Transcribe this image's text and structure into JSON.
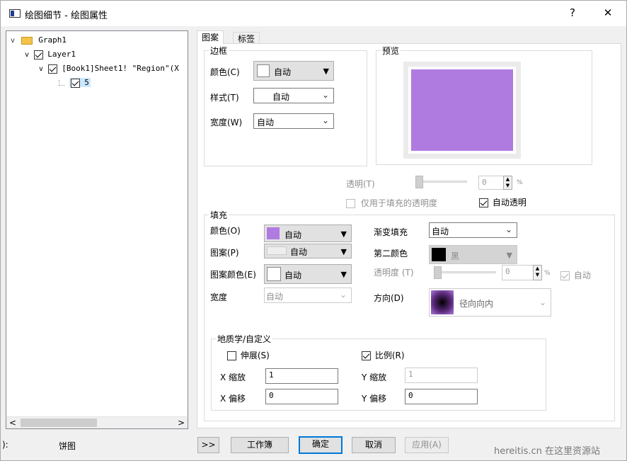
{
  "window": {
    "title": "绘图细节 - 绘图属性",
    "help": "?",
    "close": "✕"
  },
  "tree": {
    "items": [
      {
        "label": "Graph1",
        "checked": false
      },
      {
        "label": "Layer1",
        "checked": true
      },
      {
        "label": "[Book1]Sheet1! \"Region\"(X",
        "checked": true
      },
      {
        "label": "5",
        "checked": true
      }
    ]
  },
  "tabs": [
    {
      "label": "图案"
    },
    {
      "label": "标签"
    }
  ],
  "border": {
    "group": "边框",
    "color_label": "颜色(C)",
    "color_value": "自动",
    "style_label": "样式(T)",
    "style_value": "自动",
    "width_label": "宽度(W)",
    "width_value": "自动"
  },
  "preview": {
    "group": "预览",
    "fill_color": "#b07be0"
  },
  "transparency": {
    "label": "透明(T)",
    "value": "0",
    "unit": "%",
    "fill_only_label": "仅用于填充的透明度",
    "fill_only_checked": false,
    "auto_label": "自动透明",
    "auto_checked": true
  },
  "fill": {
    "group": "填充",
    "color_label": "颜色(O)",
    "color_value": "自动",
    "color_swatch": "#b07be0",
    "pattern_label": "图案(P)",
    "pattern_value": "自动",
    "pattern_color_label": "图案颜色(E)",
    "pattern_color_value": "自动",
    "width_label": "宽度",
    "width_value": "自动",
    "gradient_label": "渐变填充",
    "gradient_value": "自动",
    "second_color_label": "第二颜色",
    "second_color_value": "黑",
    "opacity_label": "透明度 (T)",
    "opacity_value": "0",
    "opacity_unit": "%",
    "opacity_auto_label": "自动",
    "direction_label": "方向(D)",
    "direction_value": "径向向内"
  },
  "geo": {
    "group": "地质学/自定义",
    "stretch_label": "伸展(S)",
    "stretch_checked": false,
    "scale_label": "比例(R)",
    "scale_checked": true,
    "x_scale_label": "X 缩放",
    "x_scale_value": "1",
    "y_scale_label": "Y 缩放",
    "y_scale_value": "1",
    "x_offset_label": "X 偏移",
    "x_offset_value": "0",
    "y_offset_label": "Y 偏移",
    "y_offset_value": "0"
  },
  "footer": {
    "left_label": "):",
    "plot_type": "饼图",
    "expand_button": ">>",
    "workbook_button": "工作簿",
    "ok_button": "确定",
    "cancel_button": "取消",
    "apply_button": "应用(A)",
    "watermark": "hereitis.cn 在这里资源站"
  }
}
